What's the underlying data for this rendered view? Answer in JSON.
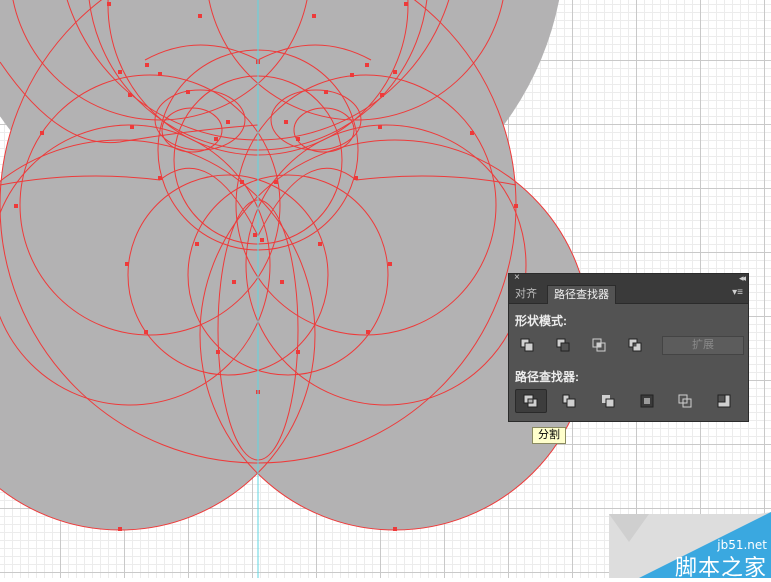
{
  "panel": {
    "close_glyph": "×",
    "collapse_glyph": "◂◂",
    "tabs": [
      {
        "label": "对齐"
      },
      {
        "label": "路径查找器"
      }
    ],
    "menu_glyph": "▾≡",
    "shape_modes_label": "形状模式:",
    "shape_mode_buttons": [
      {
        "icon": "unite-icon"
      },
      {
        "icon": "minus-front-icon"
      },
      {
        "icon": "intersect-icon"
      },
      {
        "icon": "exclude-icon"
      }
    ],
    "expand_label": "扩展",
    "pathfinders_label": "路径查找器:",
    "pathfinder_buttons": [
      {
        "icon": "divide-icon",
        "selected": true
      },
      {
        "icon": "trim-icon"
      },
      {
        "icon": "merge-icon"
      },
      {
        "icon": "crop-icon"
      },
      {
        "icon": "outline-icon"
      },
      {
        "icon": "minus-back-icon"
      }
    ]
  },
  "tooltip": {
    "text": "分割"
  },
  "watermark": {
    "url": "jb51.net",
    "text": "脚本之家"
  },
  "colors": {
    "shape_fill": "#b3b2b3",
    "path_stroke": "#ee3a3a",
    "guide": "#5fd6e0",
    "panel_bg": "#535353",
    "watermark_blue": "#3aa8e0"
  }
}
